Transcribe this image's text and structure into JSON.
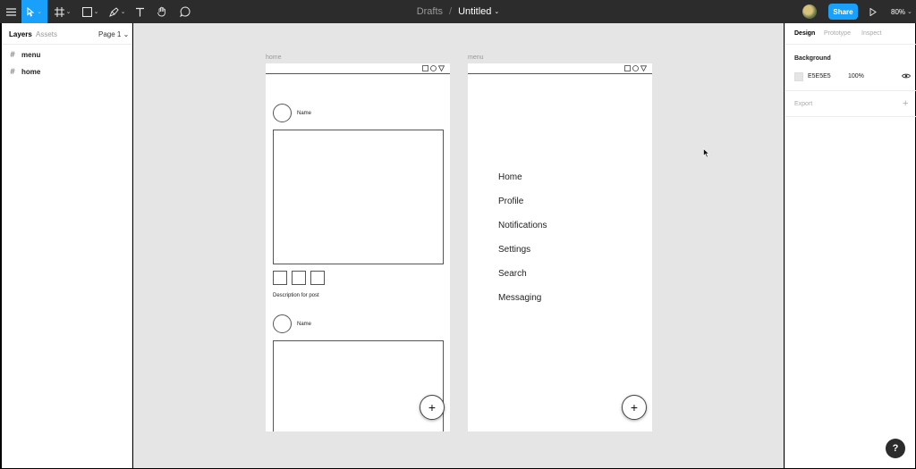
{
  "toolbar": {
    "breadcrumb": "Drafts",
    "separator": "/",
    "file_name": "Untitled",
    "file_caret": "⌄",
    "share_label": "Share",
    "zoom_label": "80%",
    "tool_caret": "⌄"
  },
  "left_panel": {
    "tabs": [
      "Layers",
      "Assets"
    ],
    "page_selector": "Page 1 ⌄",
    "layers": [
      {
        "icon": "#",
        "label": "menu"
      },
      {
        "icon": "#",
        "label": "home"
      }
    ]
  },
  "canvas": {
    "background": "#E5E5E5",
    "home_frame": {
      "label": "home",
      "posts": [
        {
          "name": "Name",
          "description": "Description for post"
        },
        {
          "name": "Name"
        }
      ],
      "fab_label": "+"
    },
    "menu_frame": {
      "label": "menu",
      "items": [
        "Home",
        "Profile",
        "Notifications",
        "Settings",
        "Search",
        "Messaging"
      ],
      "fab_label": "+"
    }
  },
  "right_panel": {
    "tabs": [
      "Design",
      "Prototype",
      "Inspect"
    ],
    "background_title": "Background",
    "background_hex": "E5E5E5",
    "background_opacity": "100%",
    "export_title": "Export",
    "export_add": "+"
  },
  "help_label": "?",
  "colors": {
    "accent": "#18A0FB",
    "toolbar": "#2C2C2C",
    "canvas": "#E5E5E5"
  }
}
